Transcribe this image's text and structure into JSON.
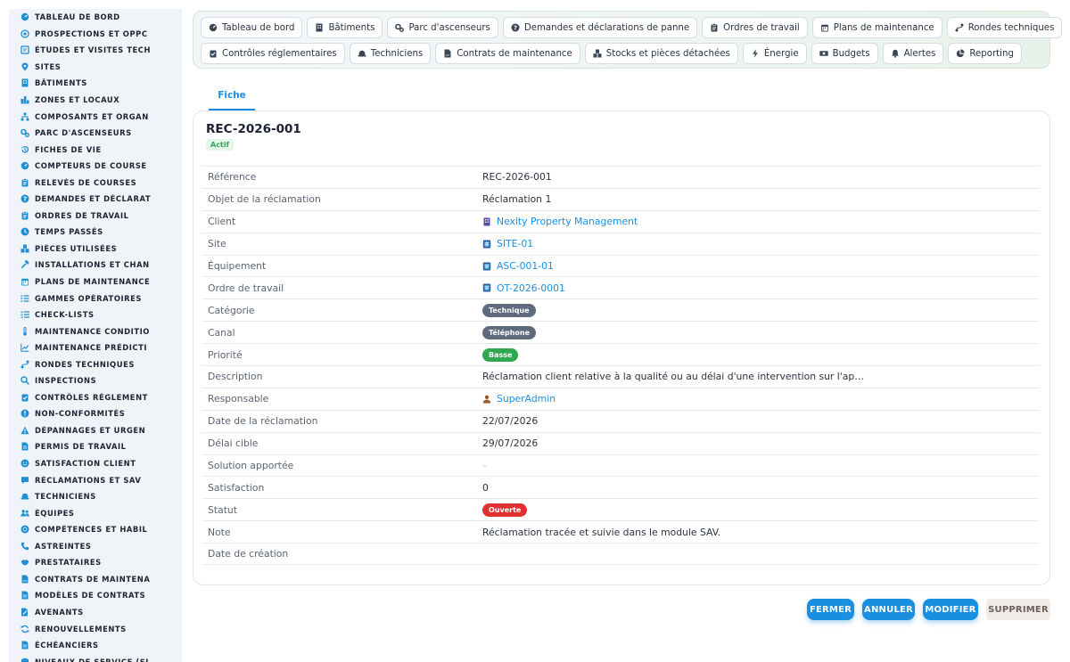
{
  "sidebar": {
    "items": [
      {
        "label": "TABLEAU DE BORD",
        "icon": "dashboard-icon"
      },
      {
        "label": "PROSPECTIONS ET OPPC",
        "icon": "target-icon"
      },
      {
        "label": "ÉTUDES ET VISITES TECH",
        "icon": "study-icon"
      },
      {
        "label": "SITES",
        "icon": "map-pin-icon"
      },
      {
        "label": "BÂTIMENTS",
        "icon": "building-icon"
      },
      {
        "label": "ZONES ET LOCAUX",
        "icon": "zones-icon"
      },
      {
        "label": "COMPOSANTS ET ORGAN",
        "icon": "sitemap-icon"
      },
      {
        "label": "PARC D'ASCENSEURS",
        "icon": "gears-icon"
      },
      {
        "label": "FICHES DE VIE",
        "icon": "history-icon"
      },
      {
        "label": "COMPTEURS DE COURSE",
        "icon": "gauge-icon"
      },
      {
        "label": "RELEVÉS DE COURSES",
        "icon": "clipboard-icon"
      },
      {
        "label": "DEMANDES ET DÉCLARAT",
        "icon": "question-icon"
      },
      {
        "label": "ORDRES DE TRAVAIL",
        "icon": "clipboard-icon"
      },
      {
        "label": "TEMPS PASSÉS",
        "icon": "clock-icon"
      },
      {
        "label": "PIÈCES UTILISÉES",
        "icon": "boxes-icon"
      },
      {
        "label": "INSTALLATIONS ET CHAN",
        "icon": "hammer-icon"
      },
      {
        "label": "PLANS DE MAINTENANCE",
        "icon": "calendar-icon"
      },
      {
        "label": "GAMMES OPÉRATOIRES",
        "icon": "list-icon"
      },
      {
        "label": "CHECK-LISTS",
        "icon": "checklist-icon"
      },
      {
        "label": "MAINTENANCE CONDITIO",
        "icon": "thermometer-icon"
      },
      {
        "label": "MAINTENANCE PRÉDICTI",
        "icon": "chart-icon"
      },
      {
        "label": "RONDES TECHNIQUES",
        "icon": "route-icon"
      },
      {
        "label": "INSPECTIONS",
        "icon": "search-icon"
      },
      {
        "label": "CONTRÔLES RÉGLEMENT",
        "icon": "clipboard-check-icon"
      },
      {
        "label": "NON-CONFORMITÉS",
        "icon": "alert-circle-icon"
      },
      {
        "label": "DÉPANNAGES ET URGEN",
        "icon": "warning-icon"
      },
      {
        "label": "PERMIS DE TRAVAIL",
        "icon": "file-icon"
      },
      {
        "label": "SATISFACTION CLIENT",
        "icon": "smile-icon"
      },
      {
        "label": "RÉCLAMATIONS ET SAV",
        "icon": "comment-icon"
      },
      {
        "label": "TECHNICIENS",
        "icon": "hard-hat-icon"
      },
      {
        "label": "ÉQUIPES",
        "icon": "users-icon"
      },
      {
        "label": "COMPÉTENCES ET HABIL",
        "icon": "certificate-icon"
      },
      {
        "label": "ASTREINTES",
        "icon": "phone-icon"
      },
      {
        "label": "PRESTATAIRES",
        "icon": "handshake-icon"
      },
      {
        "label": "CONTRATS DE MAINTENA",
        "icon": "contract-icon"
      },
      {
        "label": "MODÈLES DE CONTRATS",
        "icon": "file-icon"
      },
      {
        "label": "AVENANTS",
        "icon": "file-edit-icon"
      },
      {
        "label": "RENOUVELLEMENTS",
        "icon": "refresh-icon"
      },
      {
        "label": "ÉCHÉANCIERS",
        "icon": "file-icon"
      },
      {
        "label": "NIVEAUX DE SERVICE (SL",
        "icon": "shield-icon"
      }
    ]
  },
  "topnav": {
    "row1": [
      {
        "label": "Tableau de bord",
        "icon": "dashboard-icon"
      },
      {
        "label": "Bâtiments",
        "icon": "building-icon"
      },
      {
        "label": "Parc d'ascenseurs",
        "icon": "gears-icon"
      },
      {
        "label": "Demandes et déclarations de panne",
        "icon": "question-icon"
      },
      {
        "label": "Ordres de travail",
        "icon": "clipboard-icon"
      },
      {
        "label": "Plans de maintenance",
        "icon": "calendar-icon"
      },
      {
        "label": "Rondes techniques",
        "icon": "route-icon"
      }
    ],
    "row2": [
      {
        "label": "Contrôles réglementaires",
        "icon": "clipboard-check-icon"
      },
      {
        "label": "Techniciens",
        "icon": "hard-hat-icon"
      },
      {
        "label": "Contrats de maintenance",
        "icon": "contract-icon"
      },
      {
        "label": "Stocks et pièces détachées",
        "icon": "boxes-icon"
      },
      {
        "label": "Énergie",
        "icon": "bolt-icon"
      },
      {
        "label": "Budgets",
        "icon": "money-icon"
      },
      {
        "label": "Alertes",
        "icon": "bell-icon"
      },
      {
        "label": "Reporting",
        "icon": "pie-chart-icon"
      }
    ]
  },
  "tabs": {
    "fiche": "Fiche"
  },
  "record": {
    "title": "REC-2026-001",
    "status_badge": "Actif",
    "fields": [
      {
        "label": "Référence",
        "value": "REC-2026-001",
        "kind": "text"
      },
      {
        "label": "Objet de la réclamation",
        "value": "Réclamation 1",
        "kind": "text"
      },
      {
        "label": "Client",
        "value": "Nexity Property Management",
        "kind": "link",
        "icon": "building-icon"
      },
      {
        "label": "Site",
        "value": "SITE-01",
        "kind": "link",
        "icon": "record-icon"
      },
      {
        "label": "Équipement",
        "value": "ASC-001-01",
        "kind": "link",
        "icon": "record-icon"
      },
      {
        "label": "Ordre de travail",
        "value": "OT-2026-0001",
        "kind": "link",
        "icon": "record-icon"
      },
      {
        "label": "Catégorie",
        "value": "Technique",
        "kind": "pill",
        "color": "#5f6b7d"
      },
      {
        "label": "Canal",
        "value": "Téléphone",
        "kind": "pill",
        "color": "#5f6b7d"
      },
      {
        "label": "Priorité",
        "value": "Basse",
        "kind": "pill",
        "color": "#2fa84f"
      },
      {
        "label": "Description",
        "value": "Réclamation client relative à la qualité ou au délai d'une intervention sur l'ap…",
        "kind": "text"
      },
      {
        "label": "Responsable",
        "value": "SuperAdmin",
        "kind": "link",
        "icon": "user-icon"
      },
      {
        "label": "Date de la réclamation",
        "value": "22/07/2026",
        "kind": "text"
      },
      {
        "label": "Délai cible",
        "value": "29/07/2026",
        "kind": "text"
      },
      {
        "label": "Solution apportée",
        "value": "–",
        "kind": "muted"
      },
      {
        "label": "Satisfaction",
        "value": "0",
        "kind": "text"
      },
      {
        "label": "Statut",
        "value": "Ouverte",
        "kind": "pill",
        "color": "#e03131"
      },
      {
        "label": "Note",
        "value": "Réclamation tracée et suivie dans le module SAV.",
        "kind": "text"
      },
      {
        "label": "Date de création",
        "value": "",
        "kind": "text"
      }
    ]
  },
  "actions": {
    "close": "FERMER",
    "cancel": "ANNULER",
    "edit": "MODIFIER",
    "delete": "SUPPRIMER"
  },
  "colors": {
    "accent": "#1a8fe0",
    "sidebar_bg": "#f0f4f8",
    "badge_actif_bg": "#e3f6e8",
    "badge_actif_fg": "#3aa35a"
  }
}
